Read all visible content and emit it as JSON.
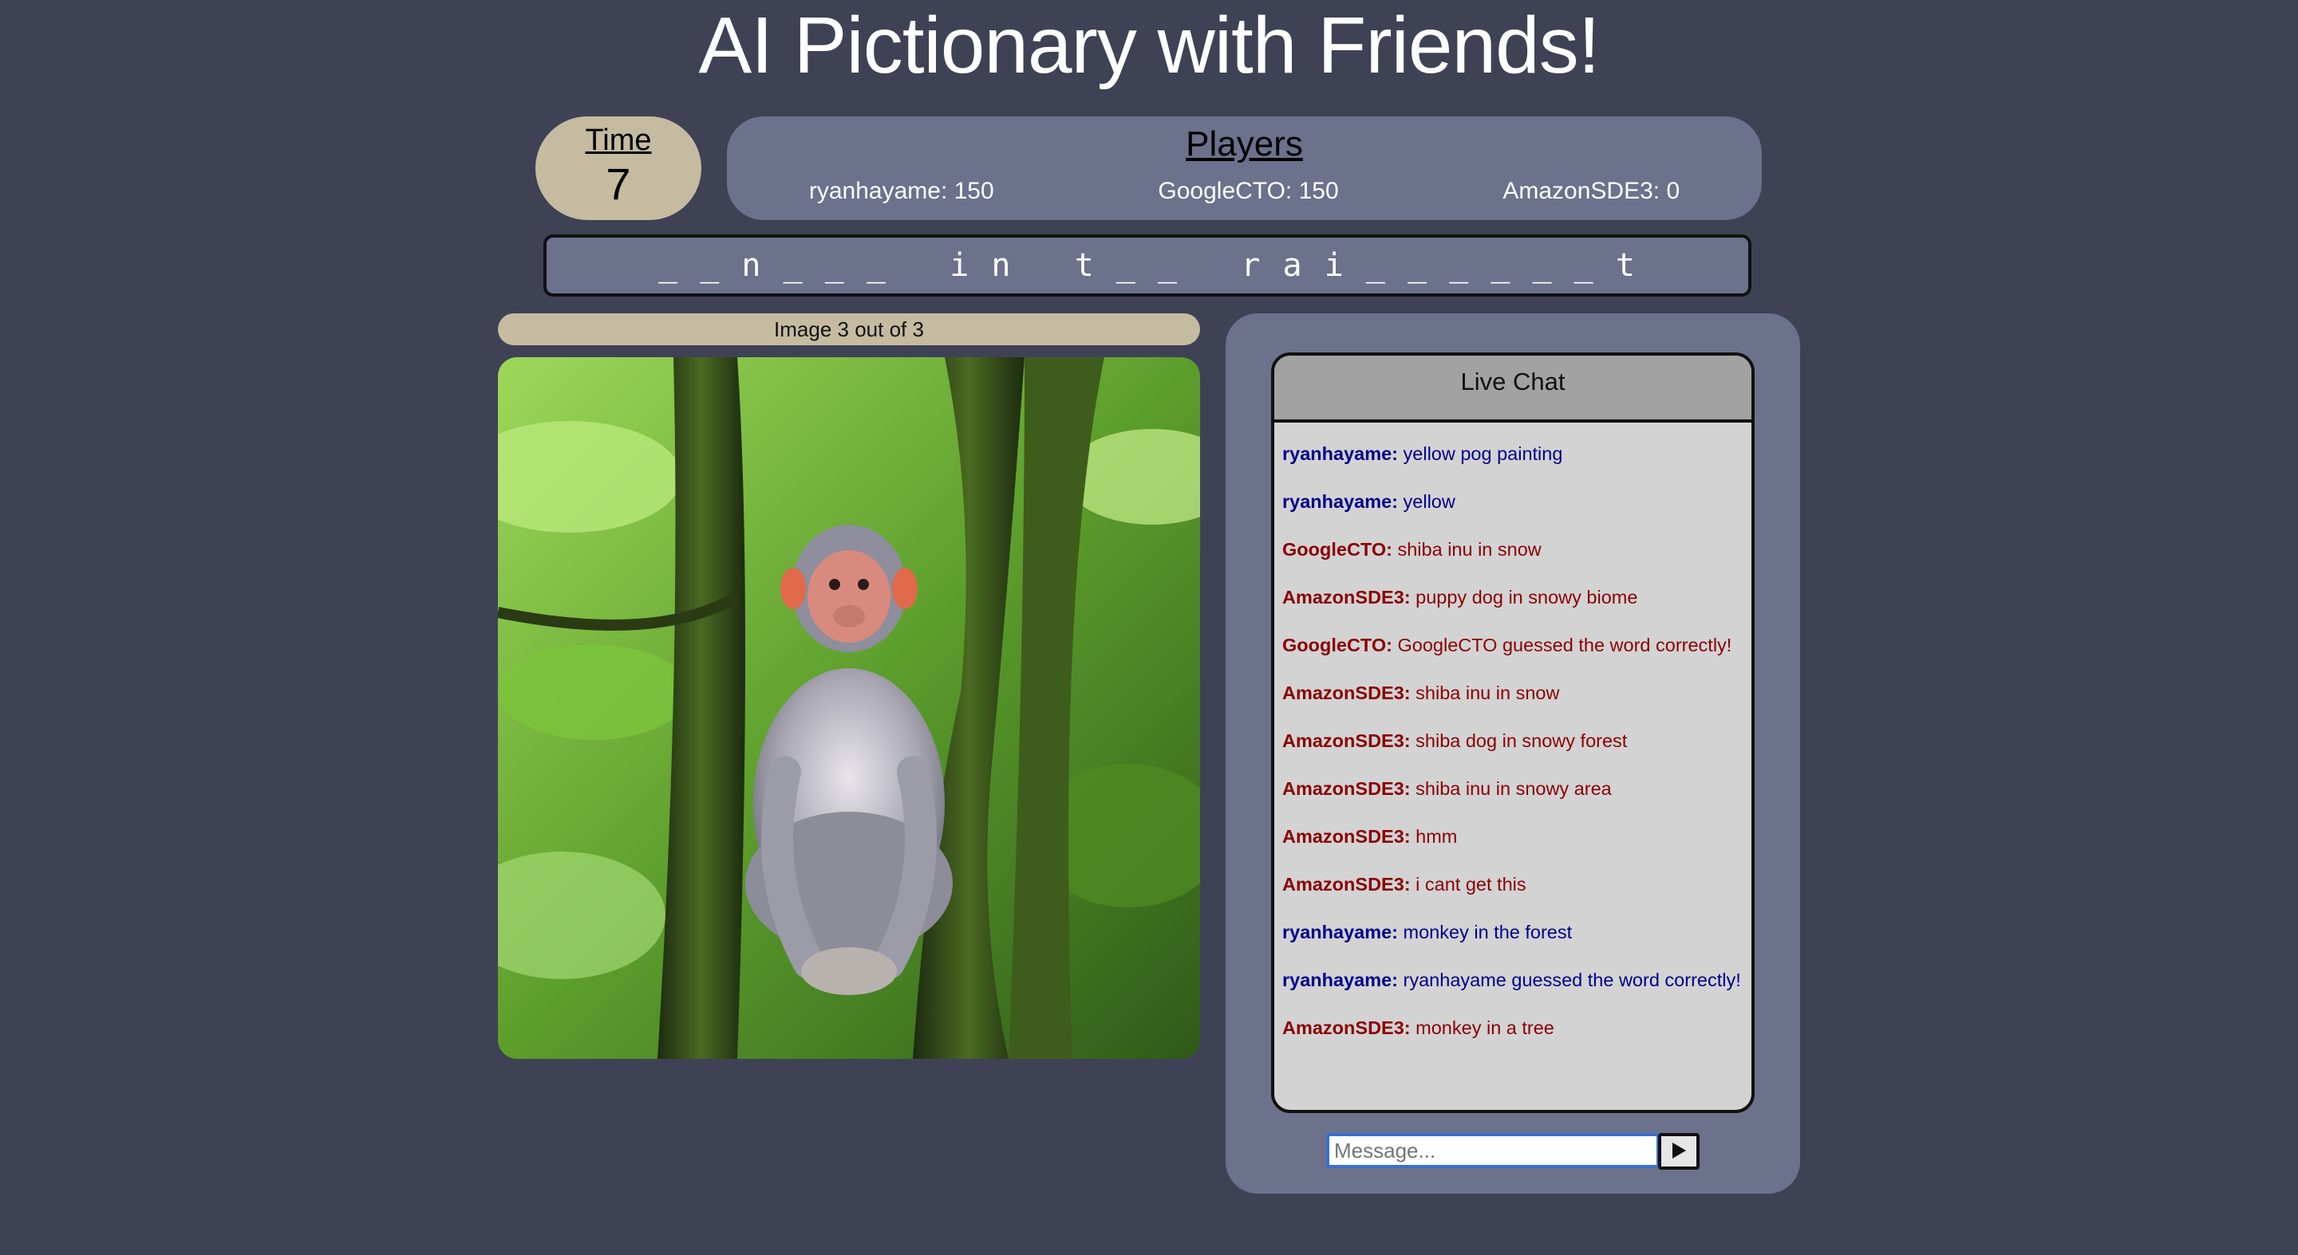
{
  "title": "AI Pictionary with Friends!",
  "timer": {
    "label": "Time",
    "value": "7"
  },
  "players": {
    "title": "Players",
    "list": [
      {
        "text": "ryanhayame: 150"
      },
      {
        "text": "GoogleCTO: 150"
      },
      {
        "text": "AmazonSDE3: 0"
      }
    ]
  },
  "word_hint": "_ _ n _ _ _   i n   t _ _   r a i _ _ _ _ _ _ t",
  "image_progress": "Image 3 out of 3",
  "chat": {
    "header": "Live Chat",
    "messages": [
      {
        "sender": "ryanhayame:",
        "text": "yellow pog painting",
        "color": "#00008b"
      },
      {
        "sender": "ryanhayame:",
        "text": "yellow",
        "color": "#00008b"
      },
      {
        "sender": "GoogleCTO:",
        "text": "shiba inu in snow",
        "color": "#8b0000"
      },
      {
        "sender": "AmazonSDE3:",
        "text": "puppy dog in snowy biome",
        "color": "#8b0000"
      },
      {
        "sender": "GoogleCTO:",
        "text": "GoogleCTO guessed the word correctly!",
        "color": "#8b0000"
      },
      {
        "sender": "AmazonSDE3:",
        "text": "shiba inu in snow",
        "color": "#8b0000"
      },
      {
        "sender": "AmazonSDE3:",
        "text": "shiba dog in snowy forest",
        "color": "#8b0000"
      },
      {
        "sender": "AmazonSDE3:",
        "text": "shiba inu in snowy area",
        "color": "#8b0000"
      },
      {
        "sender": "AmazonSDE3:",
        "text": "hmm",
        "color": "#8b0000"
      },
      {
        "sender": "AmazonSDE3:",
        "text": "i cant get this",
        "color": "#8b0000"
      },
      {
        "sender": "ryanhayame:",
        "text": "monkey in the forest",
        "color": "#00008b"
      },
      {
        "sender": "ryanhayame:",
        "text": "ryanhayame guessed the word correctly!",
        "color": "#00008b"
      },
      {
        "sender": "AmazonSDE3:",
        "text": "monkey in a tree",
        "color": "#8b0000"
      }
    ]
  },
  "input": {
    "placeholder": "Message...",
    "value": ""
  },
  "send_icon": "play-icon",
  "colors": {
    "background": "#3f4254",
    "panel": "#6c718c",
    "tan": "#c4bba1",
    "chat_bg": "#d3d3d3",
    "chat_header": "#a2a2a2"
  }
}
